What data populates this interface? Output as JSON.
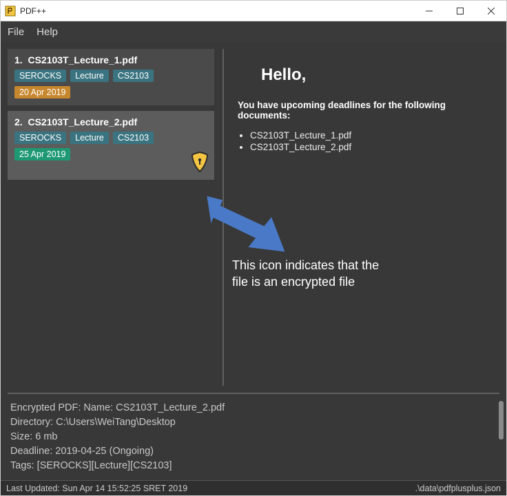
{
  "window": {
    "title": "PDF++"
  },
  "menu": {
    "file": "File",
    "help": "Help"
  },
  "list": [
    {
      "index": "1.",
      "name": "CS2103T_Lecture_1.pdf",
      "tags": [
        "SEROCKS",
        "Lecture",
        "CS2103"
      ],
      "date": "20 Apr 2019",
      "date_style": "orange",
      "encrypted": false,
      "selected": false
    },
    {
      "index": "2.",
      "name": "CS2103T_Lecture_2.pdf",
      "tags": [
        "SEROCKS",
        "Lecture",
        "CS2103"
      ],
      "date": "25 Apr 2019",
      "date_style": "teal",
      "encrypted": true,
      "selected": true
    }
  ],
  "content": {
    "greeting": "Hello,",
    "intro": "You have upcoming deadlines for the following documents:",
    "deadlines": [
      "CS2103T_Lecture_1.pdf",
      "CS2103T_Lecture_2.pdf"
    ]
  },
  "annotation": {
    "line1": "This icon indicates that the",
    "line2": "file is an encrypted file"
  },
  "details": {
    "l1": "Encrypted PDF: Name: CS2103T_Lecture_2.pdf",
    "l2": "Directory: C:\\Users\\WeiTang\\Desktop",
    "l3": "Size: 6 mb",
    "l4": "Deadline: 2019-04-25 (Ongoing)",
    "l5": "Tags: [SEROCKS][Lecture][CS2103]"
  },
  "status": {
    "left": "Last Updated: Sun Apr 14 15:52:25 SRET 2019",
    "right": ".\\data\\pdfplusplus.json"
  }
}
